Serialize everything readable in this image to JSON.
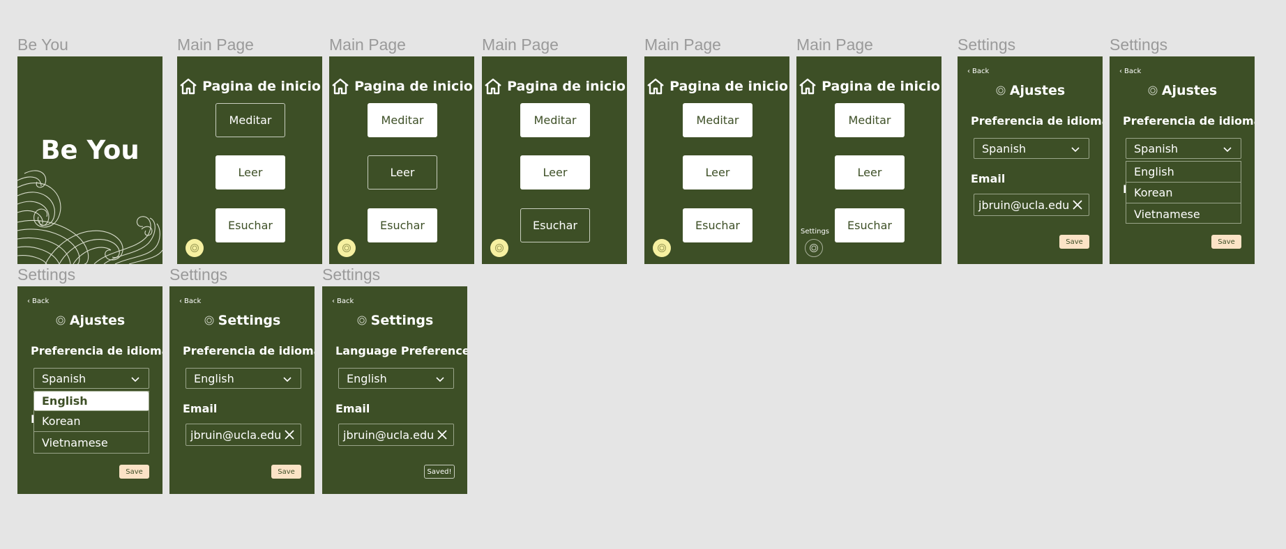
{
  "frame_labels": {
    "be_you": "Be You",
    "main_page": "Main Page",
    "settings": "Settings"
  },
  "splash": {
    "title": "Be You"
  },
  "main": {
    "title": "Pagina de inicio",
    "meditar": "Meditar",
    "leer": "Leer",
    "escuchar": "Esuchar",
    "settings_tooltip": "Settings"
  },
  "settings_es": {
    "back": "Back",
    "title": "Ajustes",
    "language_label": "Preferencia de idioma",
    "language_value": "Spanish",
    "email_label": "Email",
    "email_value": "jbruin@ucla.edu",
    "save": "Save",
    "options": [
      "English",
      "Korean",
      "Vietnamese"
    ]
  },
  "settings_mixed": {
    "title": "Settings",
    "language_label": "Preferencia de idioma",
    "language_value": "English"
  },
  "settings_en": {
    "title": "Settings",
    "language_label": "Language Preference",
    "language_value": "English",
    "saved": "Saved!"
  },
  "colors": {
    "background": "#e5e5e5",
    "frame": "#3d4f26",
    "accent_yellow": "#f6f0a1",
    "save_button": "#fbe3c6"
  }
}
